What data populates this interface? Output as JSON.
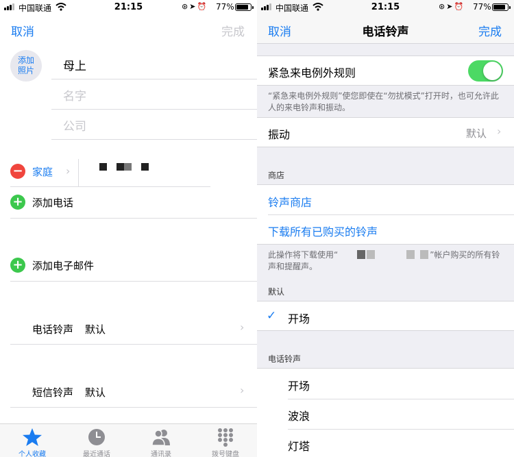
{
  "status": {
    "carrier": "中国联通",
    "time": "21:15",
    "battery": "77%",
    "battery_level": 0.77
  },
  "left": {
    "nav": {
      "cancel": "取消",
      "done": "完成"
    },
    "avatar": {
      "line1": "添加",
      "line2": "照片"
    },
    "name_value": "母上",
    "name_placeholder": "名字",
    "company_placeholder": "公司",
    "phone_label": "家庭",
    "add_phone": "添加电话",
    "add_email": "添加电子邮件",
    "ringtone": {
      "label": "电话铃声",
      "value": "默认"
    },
    "text_tone": {
      "label": "短信铃声",
      "value": "默认"
    },
    "tabs": [
      {
        "label": "个人收藏",
        "icon": "star-icon",
        "active": true
      },
      {
        "label": "最近通话",
        "icon": "clock-icon",
        "active": false
      },
      {
        "label": "通讯录",
        "icon": "contacts-icon",
        "active": false
      },
      {
        "label": "拨号键盘",
        "icon": "keypad-icon",
        "active": false
      }
    ]
  },
  "right": {
    "nav": {
      "cancel": "取消",
      "title": "电话铃声",
      "done": "完成"
    },
    "emergency": {
      "label": "紧急来电例外规则",
      "on": true,
      "note": "“紧急来电例外规则”使您即使在“勿扰模式”打开时，也可允许此人的来电铃声和振动。"
    },
    "vibration": {
      "label": "振动",
      "value": "默认"
    },
    "store": {
      "header": "商店",
      "tone_store": "铃声商店",
      "download_all": "下载所有已购买的铃声",
      "note_start": "此操作将下载使用“",
      "note_end": "”帐户购买的所有铃声和提醒声。"
    },
    "default_section": {
      "header": "默认",
      "selected": "开场"
    },
    "ringtones": {
      "header": "电话铃声",
      "items": [
        "开场",
        "波浪",
        "灯塔"
      ]
    }
  },
  "colors": {
    "accent": "#1a7cf0",
    "toggle_on": "#4cd964",
    "delete": "#f0453d",
    "add": "#3cc84d"
  }
}
